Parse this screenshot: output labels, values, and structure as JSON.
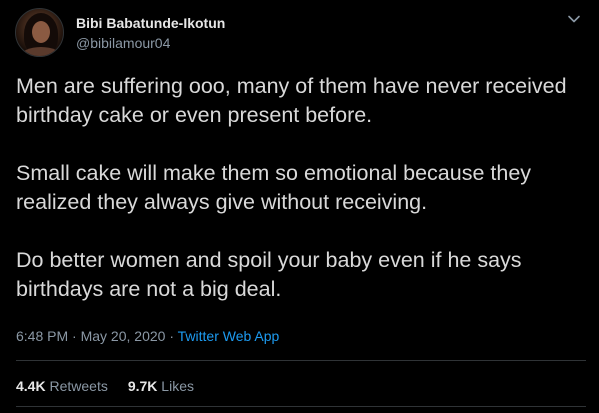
{
  "user": {
    "display_name": "Bibi Babatunde-Ikotun",
    "handle": "@bibilamour04"
  },
  "tweet": {
    "paragraphs": [
      "Men are suffering ooo, many of them have never received birthday cake or even present before.",
      "Small cake will make them so emotional because they realized they always give without receiving.",
      "Do better women and spoil your baby even if he says birthdays are not a big deal."
    ],
    "time": "6:48 PM",
    "date": "May 20, 2020",
    "source": "Twitter Web App",
    "separator": "·"
  },
  "stats": {
    "retweets_count": "4.4K",
    "retweets_label": "Retweets",
    "likes_count": "9.7K",
    "likes_label": "Likes"
  },
  "icons": {
    "menu": "chevron-down-icon",
    "avatar": "avatar"
  },
  "colors": {
    "background": "#000000",
    "text": "#d9d9d9",
    "secondary": "#8b98a5",
    "link": "#1d9bf0",
    "divider": "#2f3336"
  }
}
